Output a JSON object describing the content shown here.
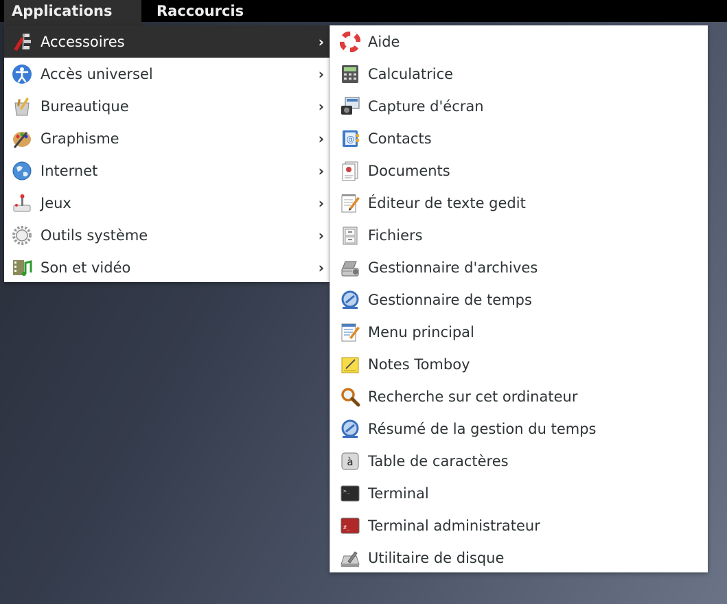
{
  "topbar": {
    "applications": "Applications",
    "raccourcis": "Raccourcis"
  },
  "menu": {
    "items": [
      {
        "label": "Accessoires",
        "arrow": "›"
      },
      {
        "label": "Accès universel",
        "arrow": "›"
      },
      {
        "label": "Bureautique",
        "arrow": "›"
      },
      {
        "label": "Graphisme",
        "arrow": "›"
      },
      {
        "label": "Internet",
        "arrow": "›"
      },
      {
        "label": "Jeux",
        "arrow": "›"
      },
      {
        "label": "Outils système",
        "arrow": "›"
      },
      {
        "label": "Son et vidéo",
        "arrow": "›"
      }
    ]
  },
  "submenu": {
    "items": [
      {
        "label": "Aide"
      },
      {
        "label": "Calculatrice"
      },
      {
        "label": "Capture d'écran"
      },
      {
        "label": "Contacts"
      },
      {
        "label": "Documents"
      },
      {
        "label": "Éditeur de texte gedit"
      },
      {
        "label": "Fichiers"
      },
      {
        "label": "Gestionnaire d'archives"
      },
      {
        "label": "Gestionnaire de temps"
      },
      {
        "label": "Menu principal"
      },
      {
        "label": "Notes Tomboy"
      },
      {
        "label": "Recherche sur cet ordinateur"
      },
      {
        "label": "Résumé de la gestion du temps"
      },
      {
        "label": "Table de caractères"
      },
      {
        "label": "Terminal"
      },
      {
        "label": "Terminal administrateur"
      },
      {
        "label": "Utilitaire de disque"
      }
    ]
  },
  "icons": {
    "char_map_glyph": "à",
    "terminal_prompt": ">_",
    "root_prompt": "#_"
  }
}
